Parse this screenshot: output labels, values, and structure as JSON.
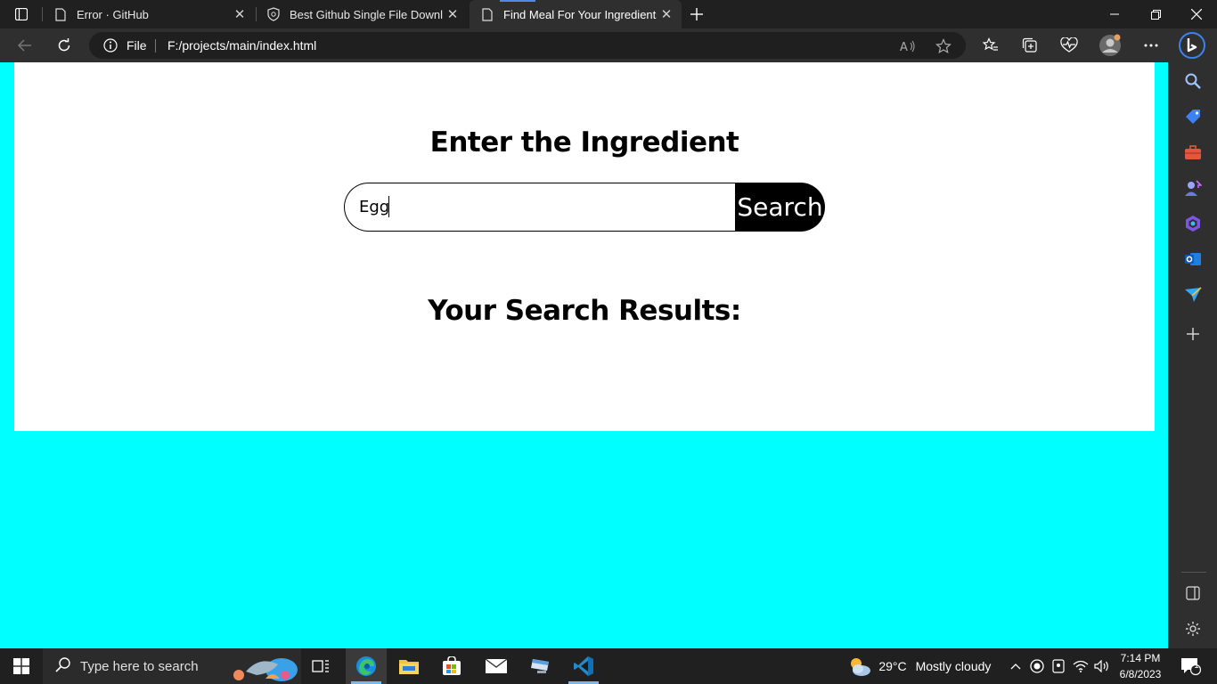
{
  "browser": {
    "tabs": [
      {
        "title": "Error · GitHub",
        "active": false
      },
      {
        "title": "Best Github Single File Downloac",
        "active": false
      },
      {
        "title": "Find Meal For Your Ingredients",
        "active": true
      }
    ],
    "address": {
      "scheme_label": "File",
      "url": "F:/projects/main/index.html"
    }
  },
  "page": {
    "heading": "Enter the Ingredient",
    "search": {
      "value": "Egg",
      "button_label": "Search"
    },
    "results_heading": "Your Search Results:"
  },
  "taskbar": {
    "search_placeholder": "Type here to search",
    "weather": {
      "temperature": "29°C",
      "condition": "Mostly cloudy"
    },
    "clock": {
      "time": "7:14 PM",
      "date": "6/8/2023"
    },
    "notification_count": "1"
  },
  "colors": {
    "page_background": "#00ffff",
    "card_background": "#ffffff",
    "button_background": "#000000",
    "browser_chrome": "#202020"
  }
}
